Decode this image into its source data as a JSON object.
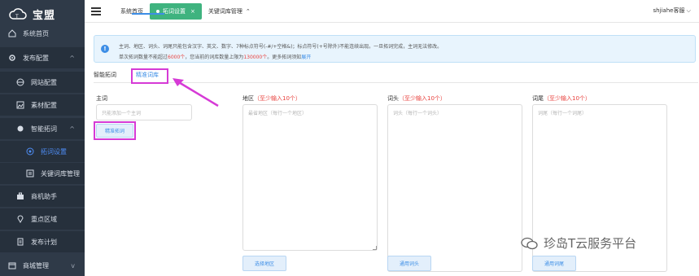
{
  "app": {
    "brand": "宝盟"
  },
  "sidebar": {
    "items": [
      {
        "label": "系统首页",
        "icon": "home-icon"
      },
      {
        "label": "发布配置",
        "icon": "gear-icon",
        "caret": "^"
      },
      {
        "label": "网站配置",
        "icon": "globe-icon"
      },
      {
        "label": "素材配置",
        "icon": "image-icon"
      },
      {
        "label": "智能拓词",
        "icon": "sparkle-icon",
        "caret": "^"
      },
      {
        "label": "拓词设置",
        "icon": "target-icon"
      },
      {
        "label": "关键词库管理",
        "icon": "list-icon"
      },
      {
        "label": "商机助手",
        "icon": "briefcase-icon"
      },
      {
        "label": "重点区域",
        "icon": "location-icon"
      },
      {
        "label": "发布计划",
        "icon": "document-icon"
      },
      {
        "label": "商城管理",
        "icon": "store-icon",
        "caret": "v"
      }
    ]
  },
  "topbar": {
    "tabs": [
      {
        "label": "系统首页"
      },
      {
        "label": "拓词设置",
        "close": "×"
      },
      {
        "label": "关键词库管理",
        "caret": "⌃"
      }
    ],
    "user": "shjiahe客服 ⌵"
  },
  "notice": {
    "line1": "主词、地区、词头、词尾只能包含汉字、英文、数字、7种标点符号(-#/+空格&)；标点符号(+号除外)不能连续出现。一旦拓词完成，主词无法修改。",
    "line2_a": "单次拓词数量不能超过",
    "line2_limit": "6000个",
    "line2_b": "，您当前的词库数量上限为",
    "line2_cap": "130000个",
    "line2_c": "。更多拓词须知",
    "line2_link": "展开"
  },
  "subtabs": {
    "smart": "智能拓词",
    "exact": "精准词库"
  },
  "form": {
    "main_label": "主词",
    "main_placeholder": "只能添加一个主词",
    "main_button": "精准拓词",
    "region_label": "地区",
    "region_hint": "（至少输入10个）",
    "region_placeholder": "最省地区（每行一个地区）",
    "region_button": "选择地区",
    "head_label": "词头",
    "head_hint": "（至少输入10个）",
    "head_placeholder": "词头（每行一个词头）",
    "head_button": "通用词头",
    "tail_label": "词尾",
    "tail_hint": "（至少输入10个）",
    "tail_placeholder": "词尾（每行一个词尾）",
    "tail_button": "通用词尾"
  },
  "watermark": {
    "text": "珍岛T云服务平台"
  },
  "colors": {
    "sidebar": "#2f3a48",
    "accent": "#3d8ee6",
    "tab_active": "#3fb37f",
    "highlight": "#d63ad6",
    "warning": "#e8413d"
  }
}
